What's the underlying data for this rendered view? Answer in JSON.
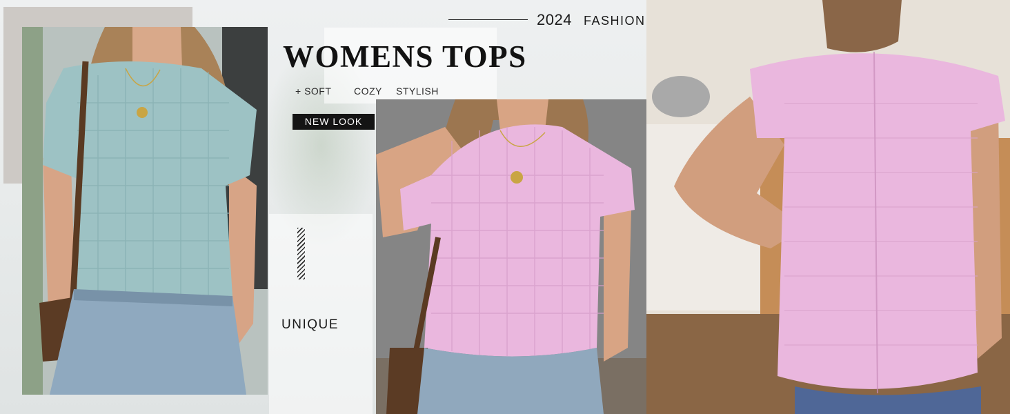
{
  "header": {
    "year": "2024",
    "tagline": "FASHION"
  },
  "title": "WOMENS TOPS",
  "features": {
    "soft": "+ SOFT",
    "cozy": "COZY",
    "stylish": "STYLISH"
  },
  "badge": "NEW LOOK",
  "bottom_word": "UNIQUE",
  "colors": {
    "top_blue": "#9dc2c4",
    "top_pink": "#eab7de",
    "badge_bg": "#141414",
    "text_dark": "#1c1c1c"
  }
}
